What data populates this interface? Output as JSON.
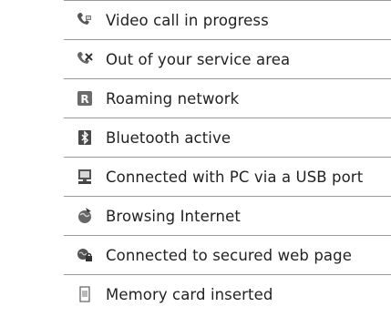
{
  "rows": [
    {
      "icon": "video-call-icon",
      "label": "Video call in progress"
    },
    {
      "icon": "no-service-icon",
      "label": "Out of your service area"
    },
    {
      "icon": "roaming-icon",
      "label": "Roaming network"
    },
    {
      "icon": "bluetooth-icon",
      "label": "Bluetooth active"
    },
    {
      "icon": "pc-usb-icon",
      "label": "Connected with PC via a USB port"
    },
    {
      "icon": "browsing-icon",
      "label": "Browsing Internet"
    },
    {
      "icon": "secured-web-icon",
      "label": "Connected to secured web page"
    },
    {
      "icon": "memory-card-icon",
      "label": "Memory card inserted"
    }
  ]
}
